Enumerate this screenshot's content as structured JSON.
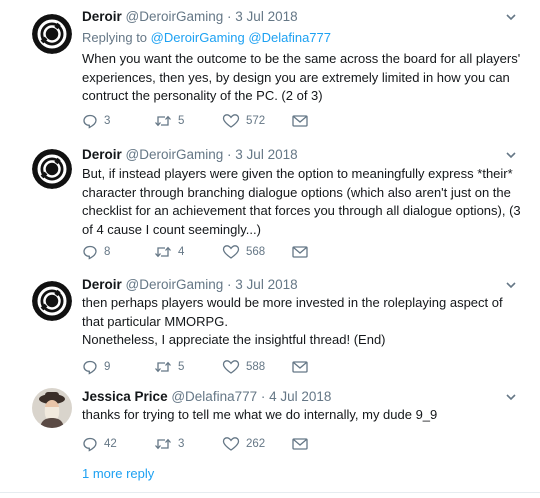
{
  "tweets": [
    {
      "name": "Deroir",
      "handle": "@DeroirGaming",
      "separator": "·",
      "date": "3 Jul 2018",
      "replying_prefix": "Replying to ",
      "replying_mentions": [
        "@DeroirGaming",
        "@Delafina777"
      ],
      "text": "When you want the outcome to be the same across the board for all players' experiences, then yes, by design you are extremely limited in how you can contruct the personality of the PC. (2 of 3)",
      "replies": "3",
      "retweets": "5",
      "likes": "572"
    },
    {
      "name": "Deroir",
      "handle": "@DeroirGaming",
      "separator": "·",
      "date": "3 Jul 2018",
      "text": "But, if instead players were given the option to meaningfully express *their* character through branching dialogue options (which also aren't just on the checklist for an achievement that forces you through all dialogue options), (3 of 4 cause I count seemingly...)",
      "replies": "8",
      "retweets": "4",
      "likes": "568"
    },
    {
      "name": "Deroir",
      "handle": "@DeroirGaming",
      "separator": "·",
      "date": "3 Jul 2018",
      "text_lines": [
        "then perhaps players would be more invested in the roleplaying aspect of that particular MMORPG.",
        "Nonetheless, I appreciate the insightful thread! (End)"
      ],
      "replies": "9",
      "retweets": "5",
      "likes": "588"
    },
    {
      "name": "Jessica Price",
      "handle": "@Delafina777",
      "separator": "·",
      "date": "4 Jul 2018",
      "text": "thanks for trying to tell me what we do internally, my dude 9_9",
      "replies": "42",
      "retweets": "3",
      "likes": "262"
    }
  ],
  "more_replies_label": "1 more reply",
  "icons": {
    "reply": "reply-icon",
    "retweet": "retweet-icon",
    "like": "heart-icon",
    "dm": "envelope-icon",
    "caret": "chevron-down-icon"
  },
  "colors": {
    "accent": "#1da1f2",
    "muted": "#657786",
    "text": "#14171a"
  }
}
